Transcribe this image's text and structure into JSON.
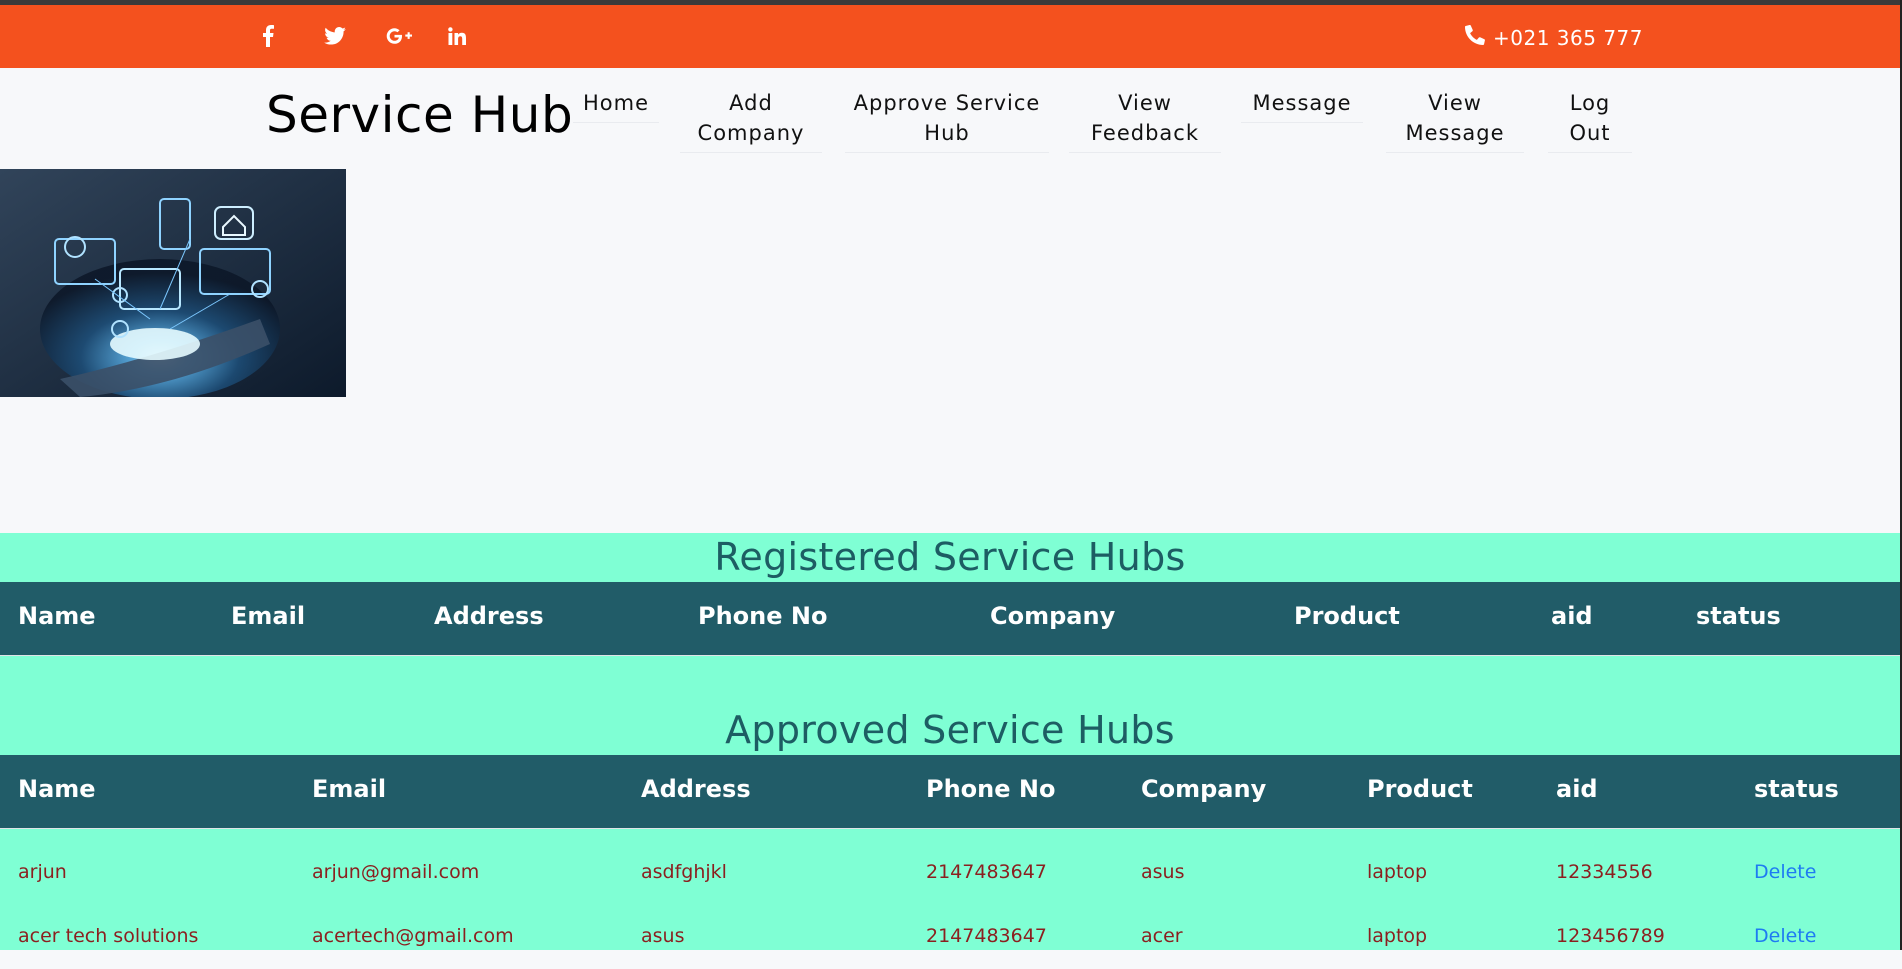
{
  "topbar": {
    "social": [
      {
        "icon": "facebook-icon",
        "glyph": "f"
      },
      {
        "icon": "twitter-icon",
        "glyph": ""
      },
      {
        "icon": "google-plus-icon",
        "glyph": "G+"
      },
      {
        "icon": "linkedin-icon",
        "glyph": "in"
      }
    ],
    "phone": "+021 365 777",
    "color": "#f4511e"
  },
  "header": {
    "brand": "Service Hub",
    "nav": [
      {
        "label": "Home"
      },
      {
        "label": "Add Company"
      },
      {
        "label": "Approve Service Hub"
      },
      {
        "label": "View Feedback"
      },
      {
        "label": "Message"
      },
      {
        "label": "View Message"
      },
      {
        "label": "Log Out"
      }
    ]
  },
  "registered": {
    "title": "Registered Service Hubs",
    "columns": [
      "Name",
      "Email",
      "Address",
      "Phone No",
      "Company",
      "Product",
      "aid",
      "status"
    ]
  },
  "approved": {
    "title": "Approved Service Hubs",
    "columns": [
      "Name",
      "Email",
      "Address",
      "Phone No",
      "Company",
      "Product",
      "aid",
      "status"
    ],
    "rows": [
      {
        "name": "arjun",
        "email": "arjun@gmail.com",
        "address": "asdfghjkl",
        "phone": "2147483647",
        "company": "asus",
        "product": "laptop",
        "aid": "12334556",
        "action": "Delete"
      },
      {
        "name": "acer tech solutions",
        "email": "acertech@gmail.com",
        "address": "asus",
        "phone": "2147483647",
        "company": "acer",
        "product": "laptop",
        "aid": "123456789",
        "action": "Delete"
      }
    ]
  },
  "colors": {
    "accent": "#f4511e",
    "table_header": "#215c68",
    "section_bg": "#7fffd4",
    "heading": "#1d5d63",
    "cell_text": "#8b1f1f",
    "link": "#1e7bf2"
  }
}
